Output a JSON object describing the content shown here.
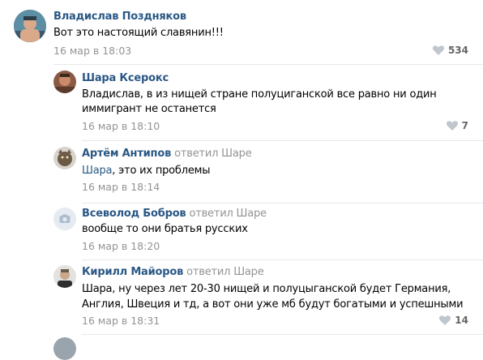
{
  "comments": [
    {
      "author": "Владислав Поздняков",
      "text_lines": [
        "Вот это настоящий славянин!!!"
      ],
      "date": "16 мар в 18:03",
      "likes": "534"
    },
    {
      "author": "Шара Ксерокс",
      "text_lines": [
        "Владислав, в из нищей стране полуциганской все равно ни один",
        "иммигрант не останется"
      ],
      "date": "16 мар в 18:10",
      "likes": "7"
    },
    {
      "author": "Артём Антипов",
      "reply_word": "ответил",
      "reply_target": "Шаре",
      "mention": "Шара",
      "text_rest": ", это их проблемы",
      "date": "16 мар в 18:14"
    },
    {
      "author": "Всеволод Бобров",
      "reply_word": "ответил",
      "reply_target": "Шаре",
      "text_lines": [
        "вообще то они братья русских"
      ],
      "date": "16 мар в 18:20"
    },
    {
      "author": "Кирилл Майоров",
      "reply_word": "ответил",
      "reply_target": "Шаре",
      "text_lines": [
        "Шара, ну через лет 20-30 нищей и полуцыганской будет Германия,",
        "Англия, Швеция и тд, а вот они уже мб будут богатыми и успешными"
      ],
      "date": "16 мар в 18:31",
      "likes": "14"
    }
  ],
  "colors": {
    "author": "#2a5885",
    "meta": "#939393",
    "divider": "#e7e8ec",
    "heart": "#c0c6cd"
  }
}
